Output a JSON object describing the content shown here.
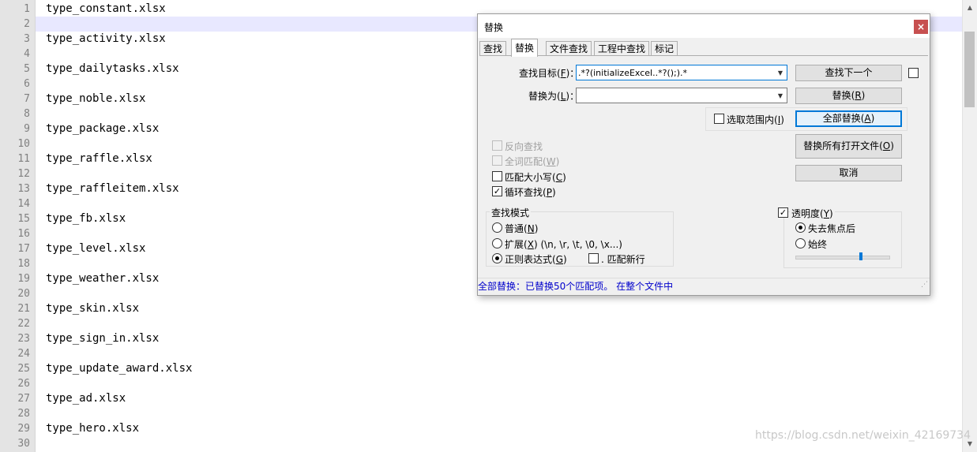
{
  "editor": {
    "lines": [
      {
        "n": "1",
        "text": "type_constant.xlsx"
      },
      {
        "n": "2",
        "text": ""
      },
      {
        "n": "3",
        "text": "type_activity.xlsx"
      },
      {
        "n": "4",
        "text": ""
      },
      {
        "n": "5",
        "text": "type_dailytasks.xlsx"
      },
      {
        "n": "6",
        "text": ""
      },
      {
        "n": "7",
        "text": "type_noble.xlsx"
      },
      {
        "n": "8",
        "text": ""
      },
      {
        "n": "9",
        "text": "type_package.xlsx"
      },
      {
        "n": "10",
        "text": ""
      },
      {
        "n": "11",
        "text": "type_raffle.xlsx"
      },
      {
        "n": "12",
        "text": ""
      },
      {
        "n": "13",
        "text": "type_raffleitem.xlsx"
      },
      {
        "n": "14",
        "text": ""
      },
      {
        "n": "15",
        "text": "type_fb.xlsx"
      },
      {
        "n": "16",
        "text": ""
      },
      {
        "n": "17",
        "text": "type_level.xlsx"
      },
      {
        "n": "18",
        "text": ""
      },
      {
        "n": "19",
        "text": "type_weather.xlsx"
      },
      {
        "n": "20",
        "text": ""
      },
      {
        "n": "21",
        "text": "type_skin.xlsx"
      },
      {
        "n": "22",
        "text": ""
      },
      {
        "n": "23",
        "text": "type_sign_in.xlsx"
      },
      {
        "n": "24",
        "text": ""
      },
      {
        "n": "25",
        "text": "type_update_award.xlsx"
      },
      {
        "n": "26",
        "text": ""
      },
      {
        "n": "27",
        "text": "type_ad.xlsx"
      },
      {
        "n": "28",
        "text": ""
      },
      {
        "n": "29",
        "text": "type_hero.xlsx"
      },
      {
        "n": "30",
        "text": ""
      }
    ],
    "current_line": 2,
    "watermark": "https://blog.csdn.net/weixin_42169734"
  },
  "dialog": {
    "title": "替换",
    "close": "×",
    "tabs": [
      "查找",
      "替换",
      "文件查找",
      "工程中查找",
      "标记"
    ],
    "active_tab": 1,
    "find_label": "查找目标",
    "find_key": "F",
    "find_value": ".*?(initializeExcel..*?();).*",
    "replace_label": "替换为",
    "replace_key": "L",
    "replace_value": "",
    "in_selection_label": "选取范围内",
    "in_selection_key": "I",
    "buttons": {
      "find_next": "查找下一个",
      "replace": "替换",
      "replace_key": "R",
      "replace_all": "全部替换",
      "replace_all_key": "A",
      "replace_all_open": "替换所有打开文件",
      "replace_all_open_key": "O",
      "cancel": "取消"
    },
    "options": {
      "backward": "反向查找",
      "whole_word": "全词匹配",
      "whole_word_key": "W",
      "match_case": "匹配大小写",
      "match_case_key": "C",
      "wrap": "循环查找",
      "wrap_key": "P"
    },
    "search_mode": {
      "title": "查找模式",
      "normal": "普通",
      "normal_key": "N",
      "extended": "扩展",
      "extended_key": "X",
      "extended_hint": "(\\n, \\r, \\t, \\0, \\x...)",
      "regex": "正则表达式",
      "regex_key": "G",
      "dot_newline": ". 匹配新行",
      "selected": "regex"
    },
    "transparency": {
      "title": "透明度",
      "title_key": "Y",
      "on_lose_focus": "失去焦点后",
      "always": "始终",
      "level": 0.7
    },
    "status": "全部替换：已替换50个匹配项。 在整个文件中"
  }
}
